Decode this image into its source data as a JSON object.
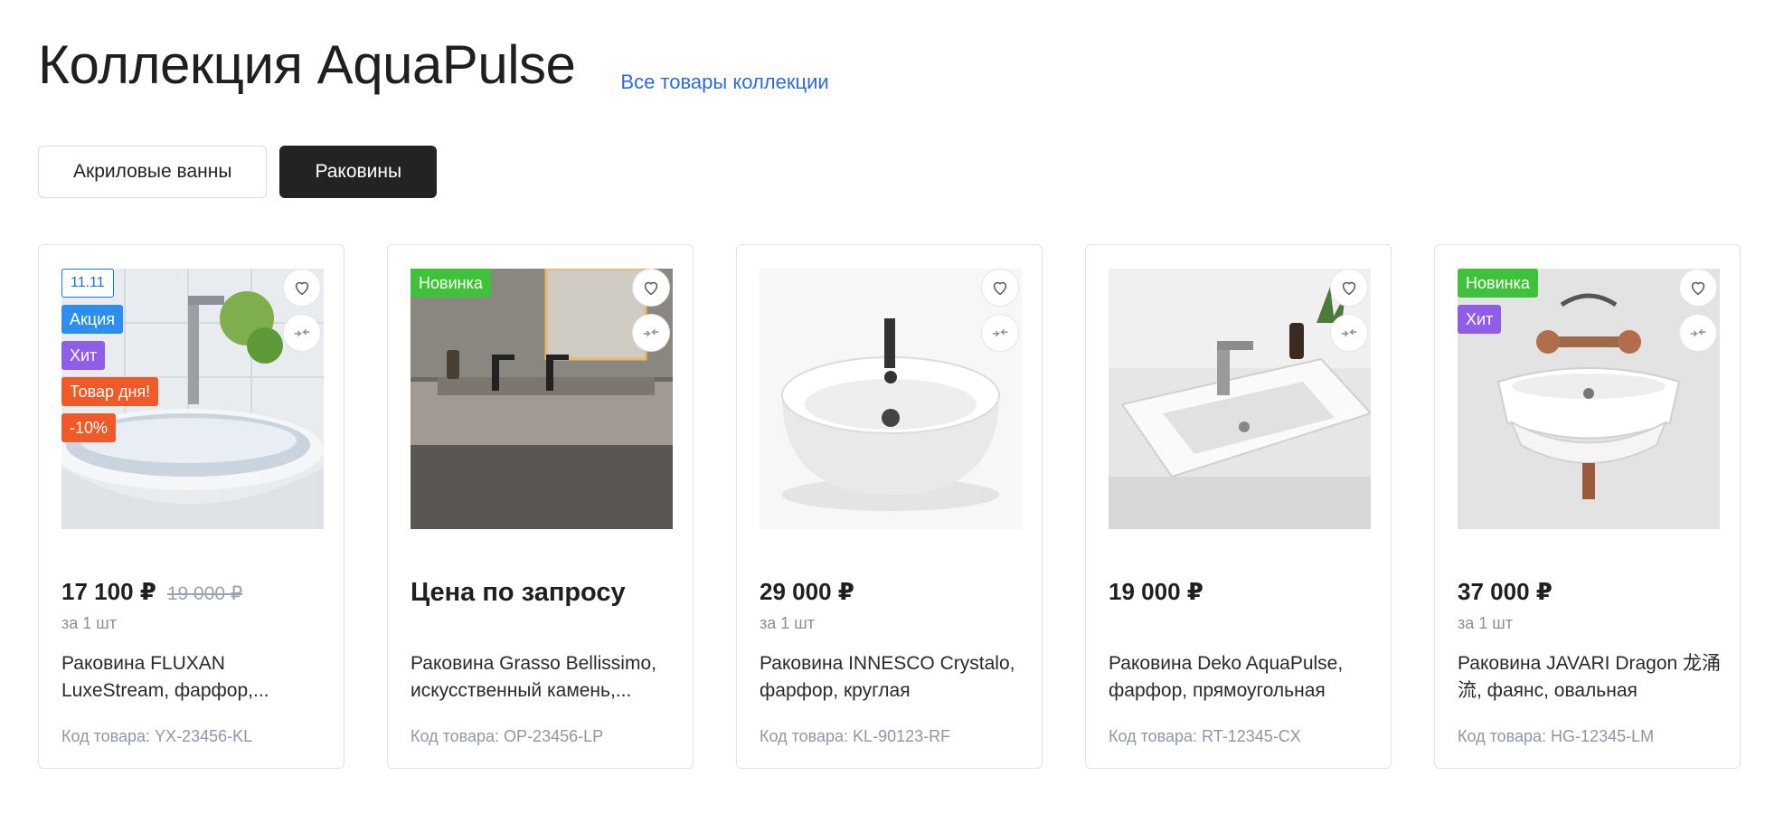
{
  "header": {
    "title": "Коллекция AquaPulse",
    "all_link": "Все товары коллекции"
  },
  "tabs": [
    {
      "label": "Акриловые ванны",
      "active": false
    },
    {
      "label": "Раковины",
      "active": true
    }
  ],
  "products": [
    {
      "badges": [
        "11.11",
        "Акция",
        "Хит",
        "Товар дня!",
        "-10%"
      ],
      "price": "17 100 ₽",
      "old_price": "19 000 ₽",
      "unit": "за 1 шт",
      "name": "Раковина FLUXAN LuxeStream, фарфор,...",
      "code": "Код товара: YX-23456-KL"
    },
    {
      "badges": [
        "Новинка"
      ],
      "price": "Цена по запросу",
      "old_price": "",
      "unit": "",
      "name": "Раковина Grasso Bellissimo, искусственный камень,...",
      "code": "Код товара: OP-23456-LP"
    },
    {
      "badges": [],
      "price": "29 000 ₽",
      "old_price": "",
      "unit": "за 1 шт",
      "name": "Раковина INNESCO Crystalo, фарфор, круглая",
      "code": "Код товара: KL-90123-RF"
    },
    {
      "badges": [],
      "price": "19 000 ₽",
      "old_price": "",
      "unit": "",
      "name": "Раковина Deko AquaPulse, фарфор, прямоугольная",
      "code": "Код товара: RT-12345-CX"
    },
    {
      "badges": [
        "Новинка",
        "Хит"
      ],
      "price": "37 000 ₽",
      "old_price": "",
      "unit": "за 1 шт",
      "name": "Раковина JAVARI Dragon 龙涌流, фаянс, овальная",
      "code": "Код товара: HG-12345-LM"
    }
  ],
  "icons": {
    "favorite": "heart-icon",
    "compare": "compare-arrows-icon"
  },
  "colors": {
    "link": "#2f6bd0",
    "active_tab": "#232323",
    "badge_outline": "#1d6fe0",
    "badge_blue": "#2d8ef0",
    "badge_purple": "#8f5ee8",
    "badge_orange": "#f05a28",
    "badge_green": "#3fc13a"
  }
}
